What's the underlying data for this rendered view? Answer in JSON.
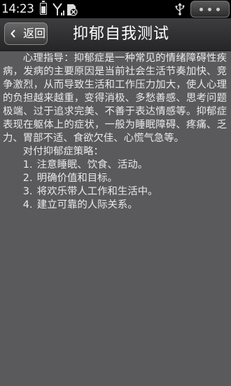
{
  "status_bar": {
    "time": "14:23",
    "icons": [
      "battery-icon",
      "signal-icon",
      "sd-card-icon",
      "usb-icon",
      "overflow-menu-icon"
    ]
  },
  "title_bar": {
    "back_label": "返回",
    "title": "抑郁自我测试"
  },
  "content": {
    "intro": "心理指导：抑郁症是一种常见的情绪障碍性疾病，发病的主要原因是当前社会生活节奏加快、竞争激烈，从而导致生活和工作压力加大，使人心理的负担越来越重，变得消极、多愁善感、思考问题极端、过于追求完美、不善于表达情感等。抑郁症表现在躯体上的症状，一般为睡眠障碍、疼痛、乏力、胃部不适、食欲欠佳、心慌气急等。",
    "strategy_heading": "对付抑郁症策略：",
    "strategies": [
      {
        "num": "1.",
        "text": "注意睡眠、饮食、活动。"
      },
      {
        "num": "2.",
        "text": "明确价值和目标。"
      },
      {
        "num": "3.",
        "text": "将欢乐带人工作和生活中。"
      },
      {
        "num": "4.",
        "text": "建立可靠的人际关系。"
      }
    ]
  },
  "colors": {
    "background": "#5a5a5c",
    "title_bar": "#2e2e30",
    "text": "#e9e9e9",
    "status_bar": "#000000"
  }
}
